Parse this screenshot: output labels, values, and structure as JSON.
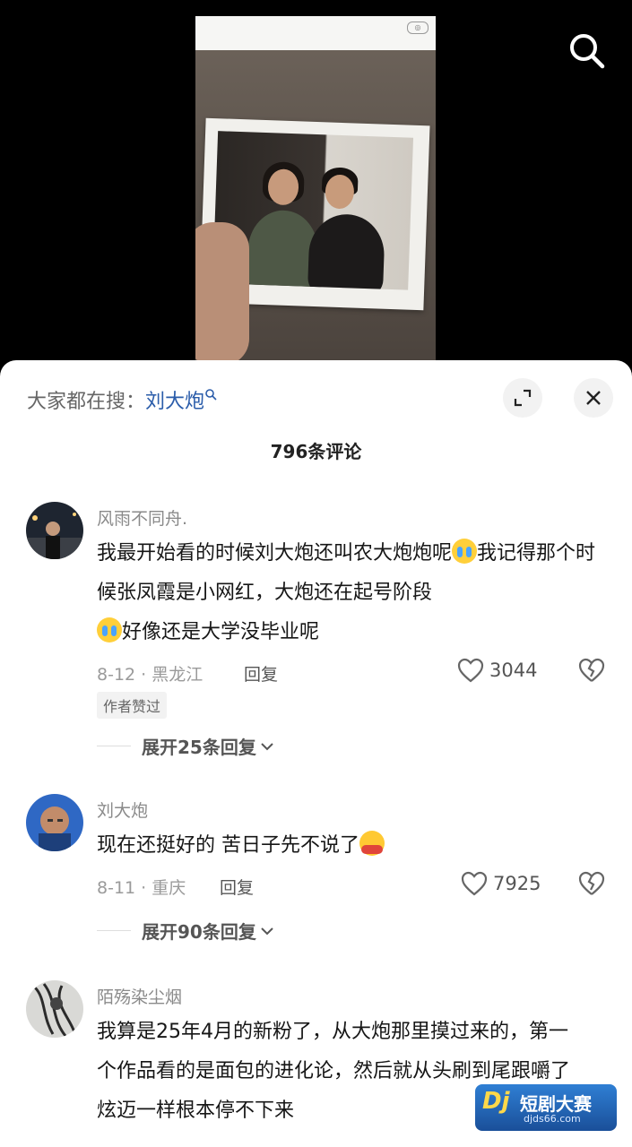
{
  "hot_search": {
    "prefix": "大家都在搜：",
    "keyword": "刘大炮"
  },
  "comment_count_label": "796条评论",
  "comments": [
    {
      "username": "风雨不同舟.",
      "text_1": "我最开始看的时候刘大炮还叫农大炮炮呢",
      "text_2": "我记得那个时候张凤霞是小网红，大炮还在起号阶段",
      "text_3": "好像还是大学没毕业呢",
      "date_location": "8-12 · 黑龙江",
      "reply_label": "回复",
      "likes": "3044",
      "badge": "作者赞过",
      "expand_label": "展开25条回复"
    },
    {
      "username": "刘大炮",
      "text_1": "现在还挺好的 苦日子先不说了",
      "date_location": "8-11 · 重庆",
      "reply_label": "回复",
      "likes": "7925",
      "expand_label": "展开90条回复"
    },
    {
      "username": "陌殇染尘烟",
      "text_1": "我算是25年4月的新粉了，从大炮那里摸过来的，第一个作品看的是面包的进化论，然后就从头刷到尾跟嚼了炫迈一样根本停不下来"
    }
  ],
  "watermark": {
    "logo": "Dj",
    "title": "短剧大赛",
    "url": "djds66.com"
  },
  "colors": {
    "keyword": "#2a5caa",
    "sheet_bg": "#ffffff",
    "muted": "#9a9a9a"
  },
  "icons": {
    "search": "search-icon",
    "expand": "expand-icon",
    "close": "close-icon",
    "like": "heart-icon",
    "dislike": "broken-heart-icon",
    "chevron": "chevron-down-icon"
  }
}
